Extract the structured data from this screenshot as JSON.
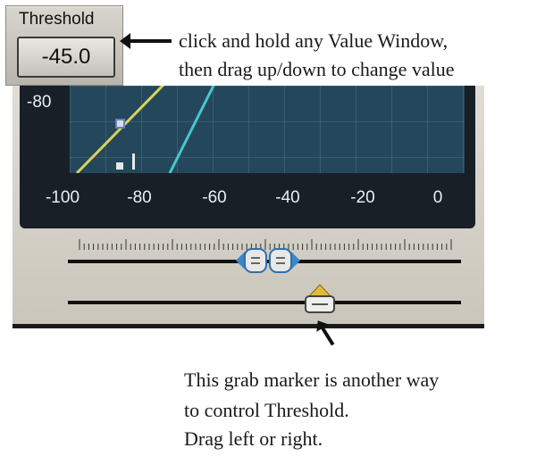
{
  "threshold": {
    "label": "Threshold",
    "value": "-45.0"
  },
  "annotations": {
    "top_line1": "click and hold any Value Window,",
    "top_line2": "then drag up/down to change value",
    "bottom_line1": "This grab marker is another way",
    "bottom_line2": "to control Threshold.",
    "bottom_line3": "Drag left or right."
  },
  "graph": {
    "y_tick": "-80",
    "x_ticks": [
      "-100",
      "-80",
      "-60",
      "-40",
      "-20",
      "0"
    ],
    "colors": {
      "curve_yellow": "#d8d35a",
      "curve_cyan": "#48c6cc",
      "grid_bg": "#24475b"
    }
  },
  "sliders": {
    "threshold_value": -45.0,
    "range_min": -100,
    "range_max": 0
  }
}
